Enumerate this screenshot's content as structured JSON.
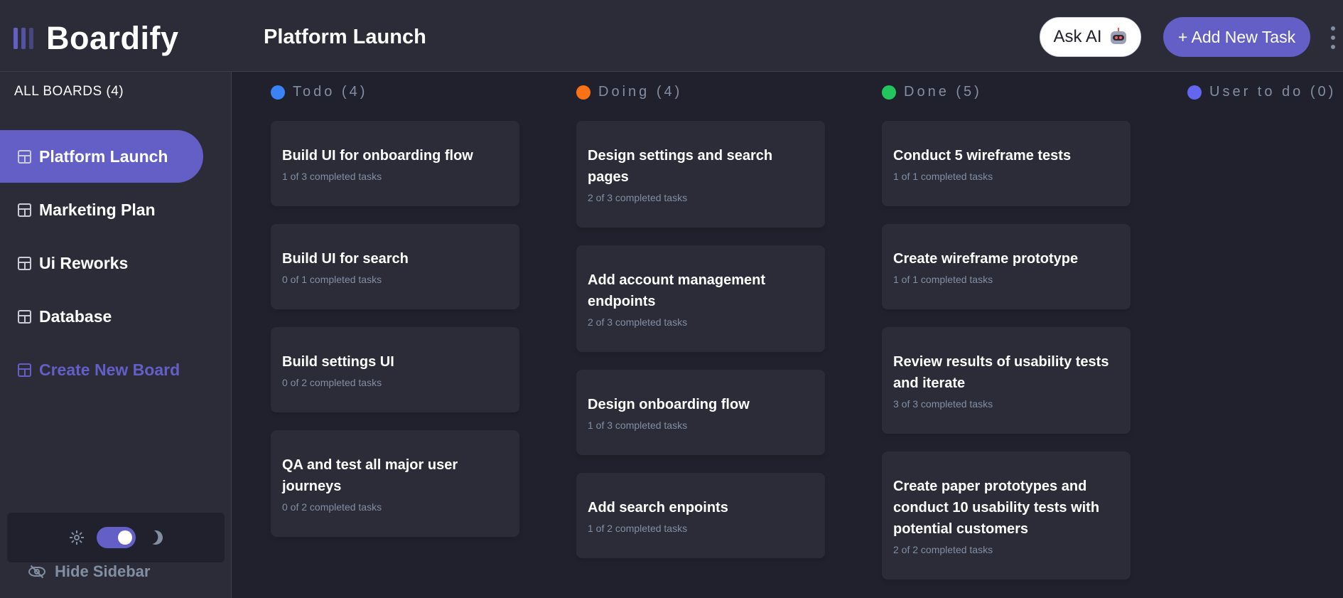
{
  "app": {
    "name": "Boardify",
    "board_title": "Platform Launch"
  },
  "header": {
    "ask_ai_label": "Ask AI",
    "add_task_label": "+ Add New Task"
  },
  "sidebar": {
    "all_boards_label": "ALL BOARDS (4)",
    "boards": [
      {
        "label": "Platform Launch",
        "active": true
      },
      {
        "label": "Marketing Plan",
        "active": false
      },
      {
        "label": "Ui Reworks",
        "active": false
      },
      {
        "label": "Database",
        "active": false
      }
    ],
    "create_label": "Create New Board",
    "hide_label": "Hide Sidebar",
    "theme": "dark"
  },
  "columns": [
    {
      "header": "Todo (4)",
      "color": "#3b82f6",
      "cards": [
        {
          "title": "Build UI for onboarding flow",
          "subtitle": "1 of 3 completed tasks"
        },
        {
          "title": "Build UI for search",
          "subtitle": "0 of 1 completed tasks"
        },
        {
          "title": "Build settings UI",
          "subtitle": "0 of 2 completed tasks"
        },
        {
          "title": "QA and test all major user journeys",
          "subtitle": "0 of 2 completed tasks"
        }
      ]
    },
    {
      "header": "Doing (4)",
      "color": "#f97316",
      "cards": [
        {
          "title": "Design settings and search pages",
          "subtitle": "2 of 3 completed tasks"
        },
        {
          "title": "Add account management endpoints",
          "subtitle": "2 of 3 completed tasks"
        },
        {
          "title": "Design onboarding flow",
          "subtitle": "1 of 3 completed tasks"
        },
        {
          "title": "Add search enpoints",
          "subtitle": "1 of 2 completed tasks"
        }
      ]
    },
    {
      "header": "Done (5)",
      "color": "#22c55e",
      "cards": [
        {
          "title": "Conduct 5 wireframe tests",
          "subtitle": "1 of 1 completed tasks"
        },
        {
          "title": "Create wireframe prototype",
          "subtitle": "1 of 1 completed tasks"
        },
        {
          "title": "Review results of usability tests and iterate",
          "subtitle": "3 of 3 completed tasks"
        },
        {
          "title": "Create paper prototypes and conduct 10 usability tests with potential customers",
          "subtitle": "2 of 2 completed tasks"
        }
      ]
    },
    {
      "header": "User to do (0)",
      "color": "#6366f1",
      "cards": []
    }
  ]
}
